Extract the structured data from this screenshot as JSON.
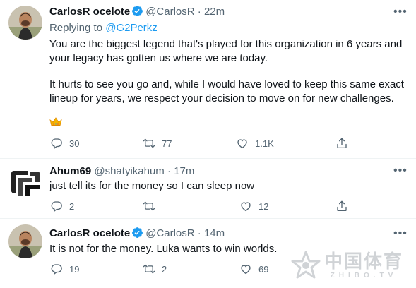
{
  "tweets": [
    {
      "name": "CarlosR ocelote",
      "handle": "@CarlosR",
      "dot": "·",
      "time": "22m",
      "replying_prefix": "Replying to",
      "replying_to": "@G2Perkz",
      "lines": [
        "You are the biggest legend that's played for this organization in 6 years and",
        "your legacy has gotten us where we are today.",
        "It hurts to see you go and, while I would have loved to keep this same exact",
        "lineup for years, we respect your decision to move on for new challenges."
      ],
      "emoji_icon": "crown-emoji-icon",
      "replies": "30",
      "retweets": "77",
      "likes": "1.1K"
    },
    {
      "name": "Ahum69",
      "handle": "@shatyikahum",
      "dot": "·",
      "time": "17m",
      "lines": [
        "just tell its for the money so I can sleep now"
      ],
      "replies": "2",
      "retweets": "",
      "likes": "12"
    },
    {
      "name": "CarlosR ocelote",
      "handle": "@CarlosR",
      "dot": "·",
      "time": "14m",
      "lines": [
        "It is not for the money. Luka wants to win worlds."
      ],
      "replies": "19",
      "retweets": "2",
      "likes": "69"
    }
  ],
  "more_icon": "more-icon",
  "verified_color": "#1d9bf0",
  "accent_color": "#1d9bf0",
  "watermark": {
    "cn": "中国体育",
    "en": "ZHIBO.TV"
  }
}
